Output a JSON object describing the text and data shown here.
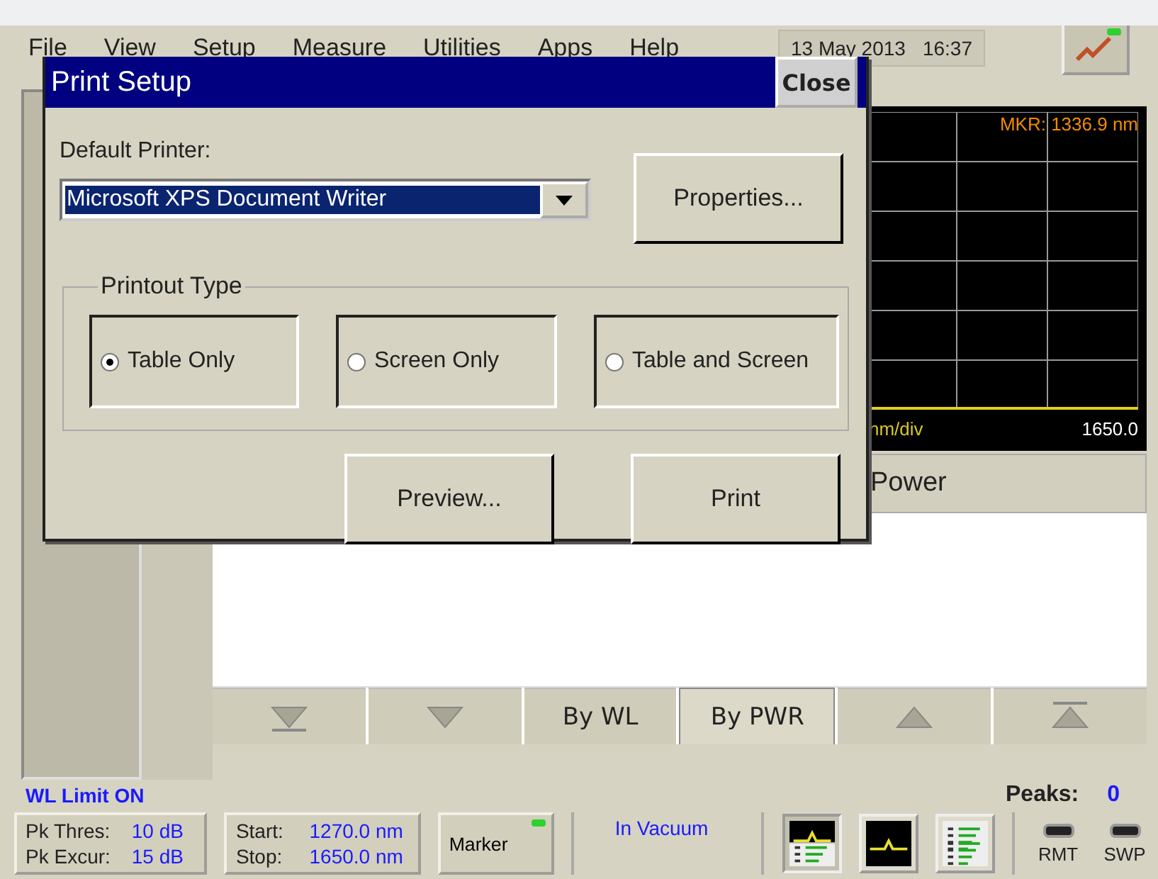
{
  "menu": [
    "File",
    "View",
    "Setup",
    "Measure",
    "Utilities",
    "Apps",
    "Help"
  ],
  "clock": {
    "date": "13 May 2013",
    "time": "16:37"
  },
  "chart": {
    "marker": "MKR: 1336.9 nm",
    "scale": "nm/div",
    "stop": "1650.0"
  },
  "table": {
    "header": "Power"
  },
  "sort_bar": [
    {
      "kind": "bottom",
      "selected": false
    },
    {
      "kind": "down",
      "selected": false
    },
    {
      "kind": "text",
      "label": "By WL",
      "selected": false
    },
    {
      "kind": "text",
      "label": "By PWR",
      "selected": true
    },
    {
      "kind": "up",
      "selected": false
    },
    {
      "kind": "top",
      "selected": false
    }
  ],
  "status": {
    "limit": "WL Limit ON",
    "peaks_label": "Peaks:",
    "peaks": "0"
  },
  "toolbar": {
    "thres_label": "Pk Thres:",
    "thres": "10 dB",
    "excur_label": "Pk Excur:",
    "excur": "15 dB",
    "start_label": "Start:",
    "start": "1270.0 nm",
    "stop_label": "Stop:",
    "stop": "1650.0 nm",
    "marker": "Marker",
    "marker_on": true,
    "medium": "In Vacuum",
    "views": [
      {
        "kind": "split",
        "selected": true
      },
      {
        "kind": "trace",
        "selected": false
      },
      {
        "kind": "table",
        "selected": false
      }
    ],
    "leds": [
      {
        "label": "RMT",
        "on": false
      },
      {
        "label": "SWP",
        "on": false
      }
    ]
  },
  "dialog": {
    "title": "Print Setup",
    "close": "Close",
    "printer_label": "Default Printer:",
    "printer": "Microsoft XPS Document Writer",
    "properties": "Properties...",
    "group": "Printout Type",
    "options": [
      {
        "label": "Table Only",
        "selected": true
      },
      {
        "label": "Screen Only",
        "selected": false
      },
      {
        "label": "Table and Screen",
        "selected": false
      }
    ],
    "buttons": [
      "Preview...",
      "Print"
    ]
  }
}
